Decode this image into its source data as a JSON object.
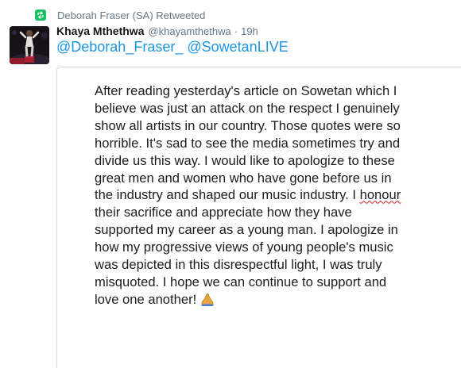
{
  "retweet": {
    "icon": "retweet-icon",
    "text": "Deborah Fraser (SA) Retweeted",
    "color": "#17bf63"
  },
  "author": {
    "avatar_icon": "user-photo-avatar",
    "display_name": "Khaya Mthethwa",
    "handle": "@khayamthethwa",
    "separator": "·",
    "time": "19h"
  },
  "tweet": {
    "mentions": [
      "@Deborah_Fraser_",
      "@SowetanLIVE"
    ],
    "link_color": "#1b95e0"
  },
  "media": {
    "text_before": "After reading yesterday's article on Sowetan which I\nbelieve was just an attack on the respect I genuinely\nshow all artists in our country. Those quotes were so\nhorrible. It's sad to see the media sometimes try and\ndivide us this way. I would like to apologize to these\ngreat men and women who have gone before us in\nthe industry and shaped our music industry. I ",
    "spellcheck_word": "honour",
    "text_after": "\ntheir sacrifice and appreciate how they have\nsupported my career as a young man. I apologize in\nhow my progressive views of young people's music\nwas depicted in this disrespectful light, I was truly\nmisquoted. I hope we can continue to support and\nlove one another!",
    "emoji_icon": "folded-hands-icon"
  }
}
